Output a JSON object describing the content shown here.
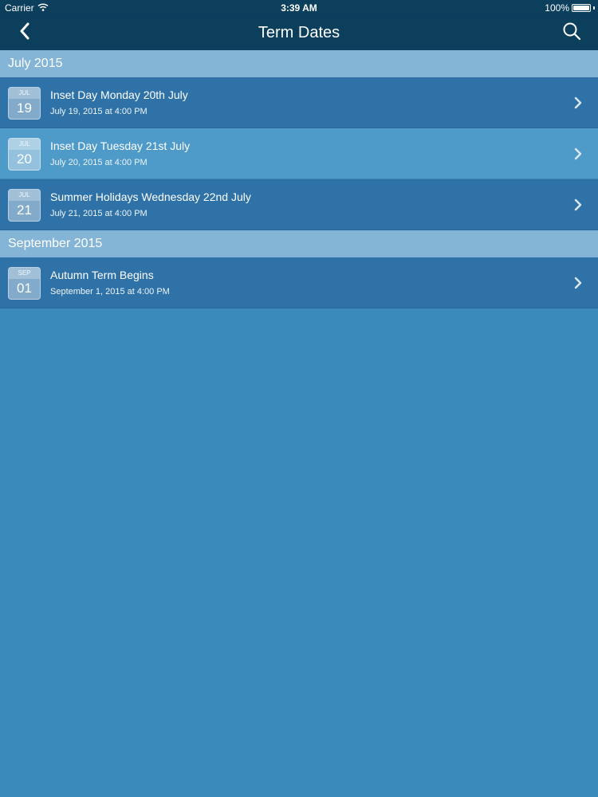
{
  "status_bar": {
    "carrier": "Carrier",
    "time": "3:39 AM",
    "battery": "100%",
    "battery_level": 1.0
  },
  "nav": {
    "title": "Term Dates",
    "back_icon": "chevron-left-icon",
    "search_icon": "search-icon"
  },
  "colors": {
    "nav_bg": "#0b3f5c",
    "section_bg": "#84b5d6",
    "row_dark": "#2f72a7",
    "row_light": "#4e9ac8",
    "page_bg": "#3b8abc"
  },
  "sections": [
    {
      "title": "July 2015",
      "events": [
        {
          "month": "JUL",
          "day": "19",
          "title": "Inset Day Monday 20th July",
          "subtitle": "July 19, 2015 at 4:00 PM"
        },
        {
          "month": "JUL",
          "day": "20",
          "title": "Inset Day Tuesday 21st July",
          "subtitle": "July 20, 2015 at 4:00 PM"
        },
        {
          "month": "JUL",
          "day": "21",
          "title": "Summer Holidays Wednesday 22nd July",
          "subtitle": "July 21, 2015 at 4:00 PM"
        }
      ]
    },
    {
      "title": "September 2015",
      "events": [
        {
          "month": "SEP",
          "day": "01",
          "title": "Autumn Term Begins",
          "subtitle": "September 1, 2015 at 4:00 PM"
        }
      ]
    }
  ]
}
